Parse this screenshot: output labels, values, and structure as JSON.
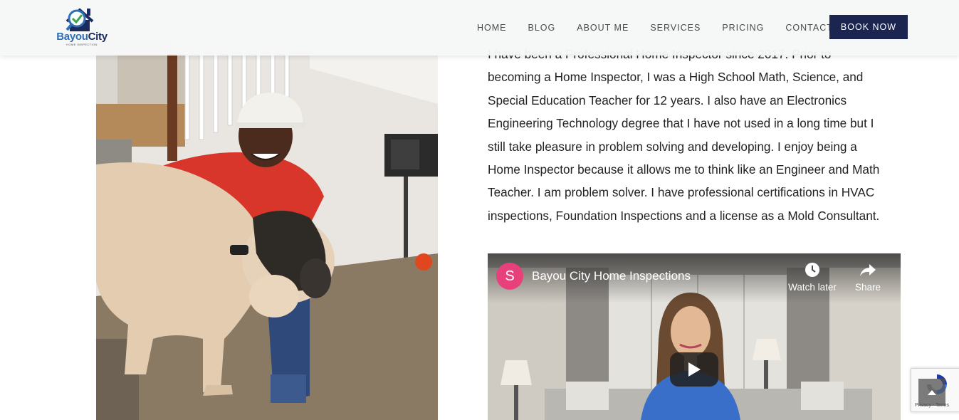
{
  "brand": {
    "name_part1": "Bayou",
    "name_part2": "City",
    "tagline": "HOME INSPECTION"
  },
  "nav": {
    "items": [
      "HOME",
      "BLOG",
      "ABOUT ME",
      "SERVICES",
      "PRICING",
      "CONTACT"
    ],
    "cta": "BOOK NOW"
  },
  "bio": {
    "lines": [
      "I have been a Professional Home Inspector since 2017. Prior to",
      "becoming a Home Inspector, I was a High School Math, Science, and",
      "Special Education Teacher for 12 years. I also have an Electronics",
      "Engineering Technology degree that I have not used in a long time but I",
      "still take pleasure in problem solving and developing. I enjoy being a",
      "Home Inspector because it allows me to think like an Engineer and Math",
      "Teacher. I am problem solver. I have professional certifications in HVAC",
      "inspections, Foundation Inspections and a license as a Mold Consultant."
    ]
  },
  "video": {
    "channel_initial": "S",
    "title": "Bayou City Home Inspections",
    "watch_later": "Watch later",
    "share": "Share"
  },
  "recaptcha": {
    "footer": "Privacy - Terms"
  },
  "colors": {
    "accent": "#1c2550",
    "header_bg": "#f6f7f7",
    "channel_avatar": "#e8407a",
    "logo_blue": "#2f6fb5",
    "logo_navy": "#1c2a5c"
  }
}
